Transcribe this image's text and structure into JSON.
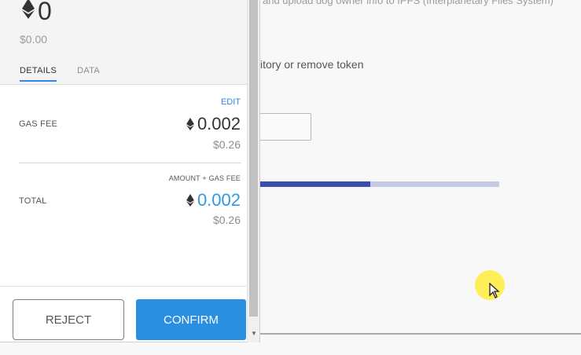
{
  "background": {
    "top_text": "and upload dog owner info to IPFS (Interplanetary Files System)",
    "repo_text": "sitory or remove token",
    "progress_fraction": 0.48
  },
  "popup": {
    "amount": "0",
    "fiat_amount": "$0.00",
    "tabs": [
      {
        "label": "DETAILS",
        "active": true
      },
      {
        "label": "DATA",
        "active": false
      }
    ],
    "edit_label": "EDIT",
    "gas_fee": {
      "label": "GAS FEE",
      "eth": "0.002",
      "fiat": "$0.26"
    },
    "total": {
      "sub_label": "AMOUNT + GAS FEE",
      "label": "TOTAL",
      "eth": "0.002",
      "fiat": "$0.26"
    },
    "reject_label": "REJECT",
    "confirm_label": "CONFIRM"
  },
  "colors": {
    "accent": "#2a8fe0",
    "total_text": "#2f9ae0",
    "progress_fill": "#3b4fb0",
    "progress_track": "#c5cbe6",
    "cursor_highlight": "#ffec3c"
  },
  "icons": {
    "eth": "ethereum-icon",
    "cursor": "mouse-pointer-icon",
    "scroll_down": "chevron-down-icon"
  }
}
